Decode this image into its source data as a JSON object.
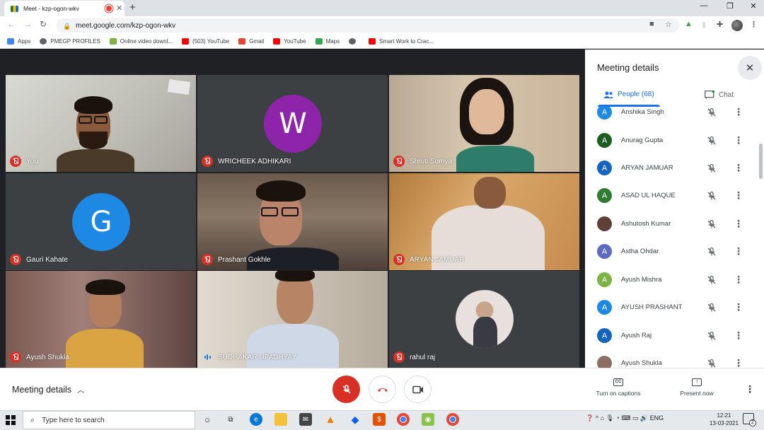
{
  "browser": {
    "tab_title": "Meet - kzp-ogon-wkv",
    "url": "meet.google.com/kzp-ogon-wkv",
    "bookmarks": [
      {
        "label": "Apps",
        "icon": "apps-grid-icon",
        "color": "#4285f4"
      },
      {
        "label": "PMEGP PROFILES",
        "icon": "globe-icon",
        "color": "#5f6368"
      },
      {
        "label": "Online video downl...",
        "icon": "download-icon",
        "color": "#7cb342"
      },
      {
        "label": "(503) YouTube",
        "icon": "youtube-icon",
        "color": "#ff0000"
      },
      {
        "label": "Gmail",
        "icon": "gmail-icon",
        "color": "#ea4335"
      },
      {
        "label": "YouTube",
        "icon": "youtube-icon",
        "color": "#ff0000"
      },
      {
        "label": "Maps",
        "icon": "maps-icon",
        "color": "#34a853"
      },
      {
        "label": "",
        "icon": "globe-icon",
        "color": "#5f6368"
      },
      {
        "label": "Smart Work to Crac...",
        "icon": "youtube-icon",
        "color": "#ff0000"
      }
    ]
  },
  "tiles": [
    {
      "name": "You",
      "status": "muted"
    },
    {
      "name": "WRICHEEK ADHIKARI",
      "status": "muted",
      "avatar_letter": "W",
      "avatar_color": "#8e24aa"
    },
    {
      "name": "Shruti Somya",
      "status": "muted"
    },
    {
      "name": "Gauri Kahate",
      "status": "muted",
      "avatar_letter": "G",
      "avatar_color": "#1e88e5"
    },
    {
      "name": "Prashant Gokhle",
      "status": "muted"
    },
    {
      "name": "ARYAN JAMUAR",
      "status": "muted"
    },
    {
      "name": "Ayush Shukla",
      "status": "muted"
    },
    {
      "name": "SUDHAKAR UPADHYAY",
      "status": "speaking"
    },
    {
      "name": "rahul raj",
      "status": "muted"
    }
  ],
  "panel": {
    "title": "Meeting details",
    "tab_people": "People (68)",
    "tab_chat": "Chat",
    "participants": [
      {
        "name": "Anshika Singh",
        "initial": "A",
        "color": "#1e88e5"
      },
      {
        "name": "Anurag Gupta",
        "initial": "A",
        "color": "#1b5e20"
      },
      {
        "name": "ARYAN JAMUAR",
        "initial": "A",
        "color": "#1565c0"
      },
      {
        "name": "ASAD UL HAQUE",
        "initial": "A",
        "color": "#2e7d32"
      },
      {
        "name": "Ashutosh Kumar",
        "initial": "",
        "color": "#5d4037"
      },
      {
        "name": "Astha Ohdar",
        "initial": "A",
        "color": "#5c6bc0"
      },
      {
        "name": "Ayush Mishra",
        "initial": "A",
        "color": "#7cb342"
      },
      {
        "name": "AYUSH PRASHANT",
        "initial": "A",
        "color": "#1e88e5"
      },
      {
        "name": "Ayush Raj",
        "initial": "A",
        "color": "#1565c0"
      },
      {
        "name": "Ayush Shukla",
        "initial": "",
        "color": "#8d6e63"
      }
    ]
  },
  "bottom": {
    "meeting_details": "Meeting details",
    "captions": "Turn on captions",
    "captions_icon": "CC",
    "present": "Present now"
  },
  "taskbar": {
    "search_placeholder": "Type here to search",
    "language": "ENG",
    "time": "12:21",
    "date": "13-03-2021",
    "notification_count": "2"
  }
}
